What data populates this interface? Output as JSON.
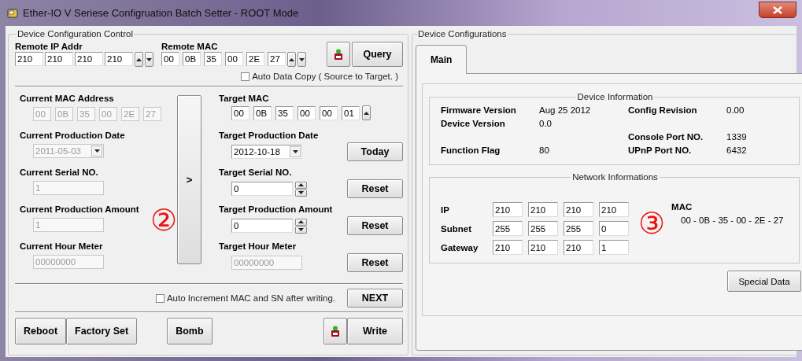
{
  "window": {
    "title": "Ether-IO V Seriese Configruation Batch Setter - ROOT Mode"
  },
  "control": {
    "title": "Device Configuration Control",
    "remote_ip": {
      "label": "Remote IP Addr",
      "octets": [
        "210",
        "210",
        "210",
        "210"
      ]
    },
    "remote_mac": {
      "label": "Remote MAC",
      "octets": [
        "00",
        "0B",
        "35",
        "00",
        "2E",
        "27"
      ]
    },
    "query_button": "Query",
    "auto_copy": {
      "label": "Auto Data Copy ( Source to Target. )",
      "checked": false
    },
    "current": [
      {
        "kind": "mac",
        "label": "Current MAC Address",
        "octets": [
          "00",
          "0B",
          "35",
          "00",
          "2E",
          "27"
        ],
        "disabled": true
      },
      {
        "kind": "date",
        "label": "Current Production Date",
        "value": "2011-05-03",
        "disabled": true
      },
      {
        "kind": "text",
        "label": "Current Serial NO.",
        "value": "1",
        "disabled": true
      },
      {
        "kind": "text",
        "label": "Current Production Amount",
        "value": "1",
        "disabled": true
      },
      {
        "kind": "text",
        "label": "Current Hour Meter",
        "value": "00000000",
        "disabled": true
      }
    ],
    "copy_button": ">",
    "target": [
      {
        "kind": "mac",
        "label": "Target MAC",
        "octets": [
          "00",
          "0B",
          "35",
          "00",
          "00",
          "01"
        ],
        "disabled": false
      },
      {
        "kind": "date",
        "label": "Target Production Date",
        "value": "2012-10-18",
        "button": "Today",
        "disabled": false
      },
      {
        "kind": "spin",
        "label": "Target Serial NO.",
        "value": "0",
        "button": "Reset",
        "disabled": false
      },
      {
        "kind": "spin",
        "label": "Target Production Amount",
        "value": "0",
        "button": "Reset",
        "disabled": false
      },
      {
        "kind": "text",
        "label": "Target Hour Meter",
        "value": "00000000",
        "button": "Reset",
        "disabled": true
      }
    ],
    "auto_increment": {
      "label": "Auto Increment MAC and SN after writing.",
      "checked": false
    },
    "next_button": "NEXT",
    "bottom_buttons": [
      "Reboot",
      "Factory Set",
      "Bomb"
    ],
    "write_button": "Write"
  },
  "configurations": {
    "title": "Device Configurations",
    "tabs": [
      {
        "label": "Main",
        "selected": true
      }
    ],
    "device_info": {
      "title": "Device Information",
      "rows": [
        {
          "left": {
            "label": "Firmware Version",
            "value": "Aug 25 2012"
          },
          "right": {
            "label": "Config Revision",
            "value": "0.00"
          }
        },
        {
          "left": {
            "label": "Device Version",
            "value": "0.0"
          }
        },
        {
          "right": {
            "label": "Console Port NO.",
            "value": "1339"
          }
        },
        {
          "left": {
            "label": "Function Flag",
            "value": "80"
          },
          "right": {
            "label": "UPnP Port NO.",
            "value": "6432"
          }
        }
      ]
    },
    "network": {
      "title": "Network Informations",
      "rows": [
        {
          "label": "IP",
          "octets": [
            "210",
            "210",
            "210",
            "210"
          ]
        },
        {
          "label": "Subnet",
          "octets": [
            "255",
            "255",
            "255",
            "0"
          ]
        },
        {
          "label": "Gateway",
          "octets": [
            "210",
            "210",
            "210",
            "1"
          ]
        }
      ],
      "mac_label": "MAC",
      "mac_value": "00 - 0B - 35 - 00 - 2E - 27"
    },
    "special_button": "Special Data"
  },
  "annotations": [
    {
      "text": "②"
    },
    {
      "text": "③"
    }
  ]
}
